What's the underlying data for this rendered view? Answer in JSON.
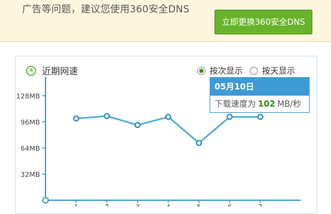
{
  "banner": {
    "text": "广告等问题，建议您使用360安全DNS",
    "button_label": "立即更换360安全DNS"
  },
  "panel": {
    "title": "近期网速",
    "radio_by_count": "按次显示",
    "radio_by_day": "按天显示",
    "selected": "按次显示"
  },
  "tooltip": {
    "date": "05月10日",
    "prefix": "下载速度为",
    "value": "102",
    "unit": "MB/秒"
  },
  "chart_data": {
    "type": "line",
    "ylim": [
      0,
      128
    ],
    "y_ticks": [
      32,
      64,
      96,
      128
    ],
    "y_tick_labels": [
      "32MB",
      "64MB",
      "96MB",
      "128MB"
    ],
    "x": [
      1,
      2,
      3,
      4,
      5,
      6,
      7
    ],
    "series": [
      {
        "values": [
          100,
          103,
          92,
          102,
          70,
          102,
          102
        ]
      }
    ],
    "colors": {
      "line": "#55b0d8",
      "point": "#2e8ec5",
      "axis": "#4aa3d9"
    }
  }
}
